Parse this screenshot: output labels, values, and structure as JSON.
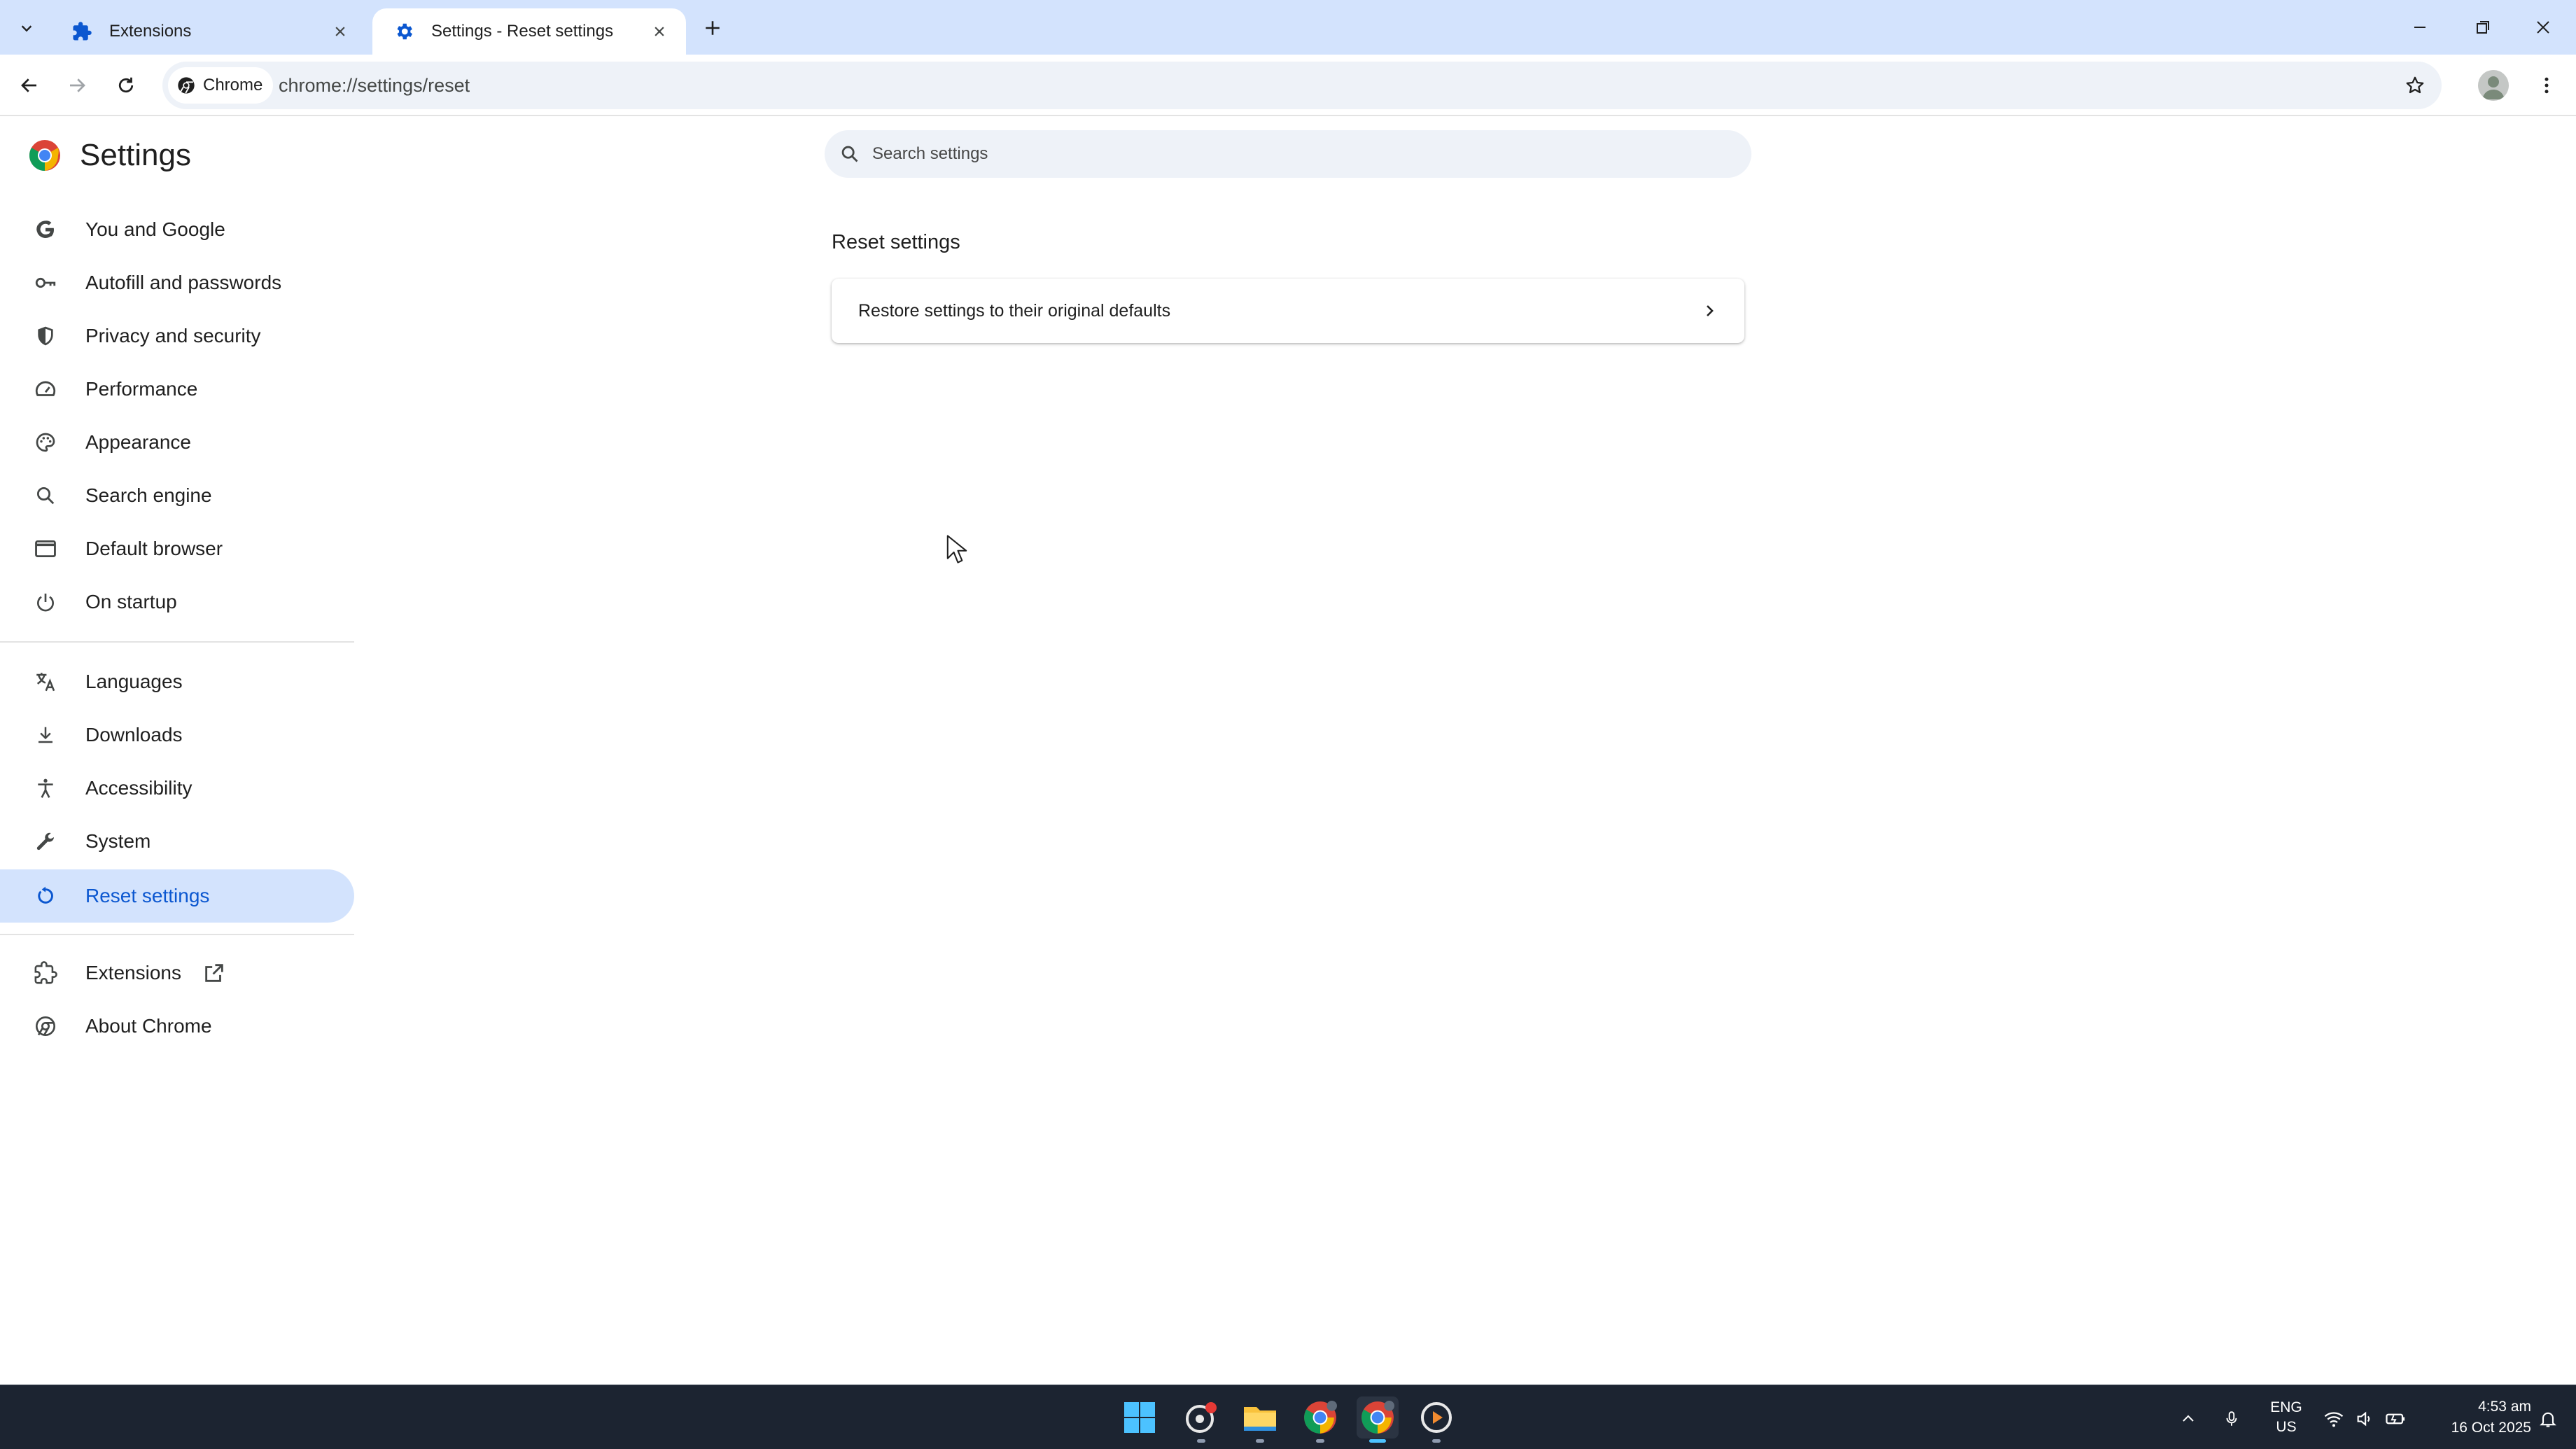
{
  "browser": {
    "tabs": [
      {
        "title": "Extensions",
        "icon": "puzzle-icon",
        "active": false
      },
      {
        "title": "Settings - Reset settings",
        "icon": "gear-icon",
        "active": true
      }
    ],
    "omnibox": {
      "chip_label": "Chrome",
      "url": "chrome://settings/reset"
    },
    "colors": {
      "tabstrip": "#d3e3fd",
      "accent": "#0b57d0",
      "omnibox": "#eef2f8"
    }
  },
  "settings": {
    "title": "Settings",
    "search_placeholder": "Search settings",
    "nav": {
      "you_and_google": "You and Google",
      "autofill": "Autofill and passwords",
      "privacy": "Privacy and security",
      "performance": "Performance",
      "appearance": "Appearance",
      "search_engine": "Search engine",
      "default_browser": "Default browser",
      "on_startup": "On startup",
      "languages": "Languages",
      "downloads": "Downloads",
      "accessibility": "Accessibility",
      "system": "System",
      "reset_settings": "Reset settings",
      "extensions": "Extensions",
      "about_chrome": "About Chrome"
    },
    "selected_nav": "Reset settings",
    "main": {
      "section_title": "Reset settings",
      "row_label": "Restore settings to their original defaults"
    }
  },
  "taskbar": {
    "language": {
      "line1": "ENG",
      "line2": "US"
    },
    "clock": {
      "time": "4:53 am",
      "date": "16 Oct 2025"
    },
    "apps": [
      "start-icon",
      "screen-recorder-icon",
      "file-explorer-icon",
      "chrome-icon",
      "chrome-icon",
      "media-player-icon"
    ]
  }
}
